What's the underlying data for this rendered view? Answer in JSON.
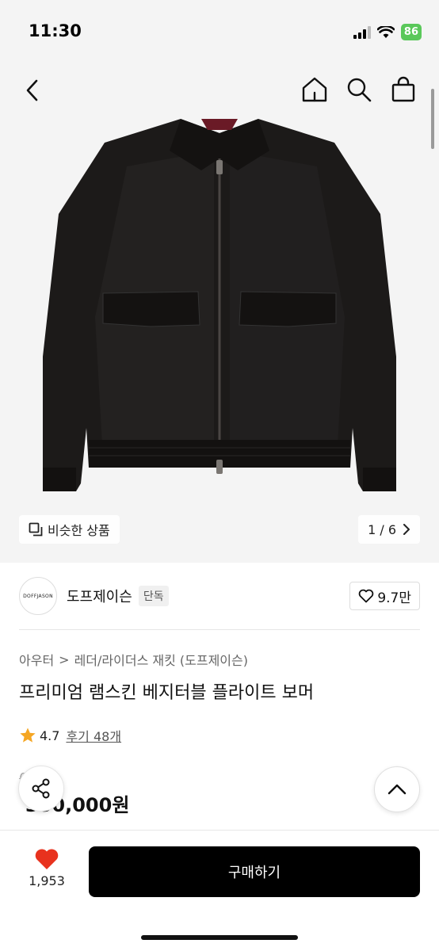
{
  "status_bar": {
    "time": "11:30",
    "battery": "86"
  },
  "hero": {
    "similar_label": "비슷한 상품",
    "pager": "1 / 6"
  },
  "brand": {
    "logo_text": "DOFFJASON",
    "name": "도프제이슨",
    "badge": "단독",
    "likes": "9.7만"
  },
  "product": {
    "breadcrumb_root": "아우터",
    "breadcrumb_sep": ">",
    "breadcrumb_leaf": "레더/라이더스 재킷 (도프제이슨)",
    "title": "프리미엄 램스킨 베지터블 플라이트 보머",
    "rating": "4.7",
    "review_link": "후기 48개",
    "original_price": "00원",
    "sale_percent": "",
    "sale_price": "350,000원"
  },
  "bottom": {
    "like_count": "1,953",
    "buy_label": "구매하기"
  },
  "colors": {
    "accent_red": "#e8321e",
    "buy_button": "#000000",
    "heart": "#e8321e",
    "star": "#f5a623"
  }
}
